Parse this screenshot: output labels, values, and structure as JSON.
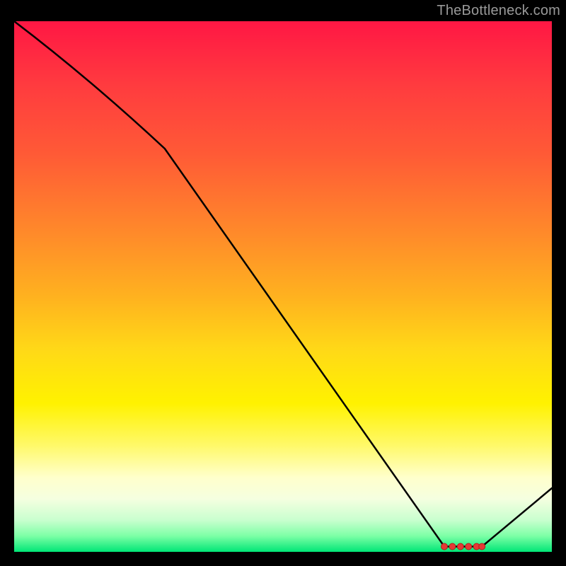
{
  "attribution": "TheBottleneck.com",
  "chart_data": {
    "type": "line",
    "title": "",
    "xlabel": "",
    "ylabel": "",
    "xlim": [
      0,
      100
    ],
    "ylim": [
      0,
      100
    ],
    "series": [
      {
        "name": "curve",
        "x": [
          0,
          28,
          80,
          87,
          100
        ],
        "y": [
          100,
          76,
          1,
          1,
          12
        ]
      }
    ],
    "markers": {
      "name": "flat-region",
      "x": [
        80,
        81.5,
        83,
        84.5,
        86,
        87
      ],
      "y": [
        1,
        1,
        1,
        1,
        1,
        1
      ]
    },
    "gradient_stops": [
      {
        "pos": 0.0,
        "color": "#ff1744"
      },
      {
        "pos": 0.12,
        "color": "#ff3b3f"
      },
      {
        "pos": 0.25,
        "color": "#ff5a36"
      },
      {
        "pos": 0.4,
        "color": "#ff8a2a"
      },
      {
        "pos": 0.52,
        "color": "#ffb21f"
      },
      {
        "pos": 0.62,
        "color": "#ffd917"
      },
      {
        "pos": 0.72,
        "color": "#fff200"
      },
      {
        "pos": 0.8,
        "color": "#fff96a"
      },
      {
        "pos": 0.86,
        "color": "#ffffcc"
      },
      {
        "pos": 0.9,
        "color": "#f5ffe0"
      },
      {
        "pos": 0.94,
        "color": "#c9ffcf"
      },
      {
        "pos": 0.97,
        "color": "#7dffa6"
      },
      {
        "pos": 1.0,
        "color": "#00e676"
      }
    ]
  }
}
